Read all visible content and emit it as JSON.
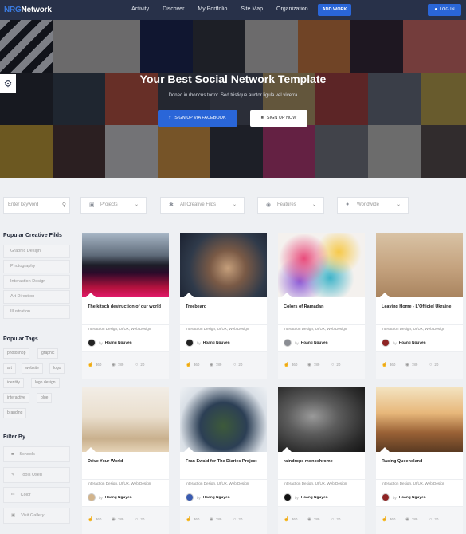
{
  "navbar": {
    "logo_prefix": "NRG",
    "logo_main": "Network",
    "links": [
      "Activity",
      "Discover",
      "My Portfolio",
      "Site Map",
      "Organization"
    ],
    "add_work": "ADD WORK",
    "login": "LOG IN"
  },
  "hero": {
    "title": "Your Best Social Network Template",
    "subtitle": "Donec in rhoncus tortor. Sed tristique auctor ligula vel viverra",
    "facebook_btn": "SIGN UP VIA FACEBOOK",
    "signup_btn": "SIGN UP NOW"
  },
  "filters": {
    "search_placeholder": "Enter keyword",
    "dropdowns": [
      {
        "label": "Projects",
        "icon": "layers-icon"
      },
      {
        "label": "All Creative Filds",
        "icon": "sparkle-icon"
      },
      {
        "label": "Features",
        "icon": "award-icon"
      },
      {
        "label": "Worldwide",
        "icon": "globe-icon"
      }
    ]
  },
  "sidebar": {
    "creative_title": "Popular Creative Filds",
    "creative_items": [
      "Graphic Design",
      "Photography",
      "Interaction Design",
      "Art Direction",
      "Illustration"
    ],
    "tags_title": "Popular Tags",
    "tags": [
      "photoshop",
      "graphic",
      "art",
      "website",
      "logo",
      "identity",
      "logo design",
      "interactive",
      "blue",
      "branding"
    ],
    "filter_title": "Filter By",
    "filter_items": [
      "Schools",
      "Tools Used",
      "Color",
      "Visit Gallery"
    ]
  },
  "cards": [
    {
      "title": "The kitsch destruction of our world",
      "cats": "Interaction Design, UI/UX, Web Design",
      "by": "by",
      "author": "Hoang Nguyen",
      "likes": "360",
      "views": "789",
      "comments": "20"
    },
    {
      "title": "Treebeard",
      "cats": "Interaction Design, UI/UX, Web Design",
      "by": "by",
      "author": "Hoang Nguyen",
      "likes": "360",
      "views": "789",
      "comments": "20"
    },
    {
      "title": "Colors of Ramadan",
      "cats": "Interaction Design, UI/UX, Web Design",
      "by": "by",
      "author": "Hoang Nguyen",
      "likes": "360",
      "views": "789",
      "comments": "20"
    },
    {
      "title": "Leaving Home - L'Officiel Ukraine",
      "cats": "Interaction Design, UI/UX, Web Design",
      "by": "by",
      "author": "Hoang Nguyen",
      "likes": "360",
      "views": "789",
      "comments": "20"
    },
    {
      "title": "Drive Your World",
      "cats": "Interaction Design, UI/UX, Web Design",
      "by": "by",
      "author": "Hoang Nguyen",
      "likes": "360",
      "views": "789",
      "comments": "20"
    },
    {
      "title": "Fran Ewald for The Diaries Project",
      "cats": "Interaction Design, UI/UX, Web Design",
      "by": "by",
      "author": "Hoang Nguyen",
      "likes": "360",
      "views": "789",
      "comments": "20"
    },
    {
      "title": "raindrops monochrome",
      "cats": "Interaction Design, UI/UX, Web Design",
      "by": "by",
      "author": "Hoang Nguyen",
      "likes": "360",
      "views": "789",
      "comments": "20"
    },
    {
      "title": "Racing Queensland",
      "cats": "Interaction Design, UI/UX, Web Design",
      "by": "by",
      "author": "Hoang Nguyen",
      "likes": "360",
      "views": "789",
      "comments": "20"
    }
  ],
  "colors": {
    "navbar": "#283149",
    "accent": "#2a66d8"
  }
}
